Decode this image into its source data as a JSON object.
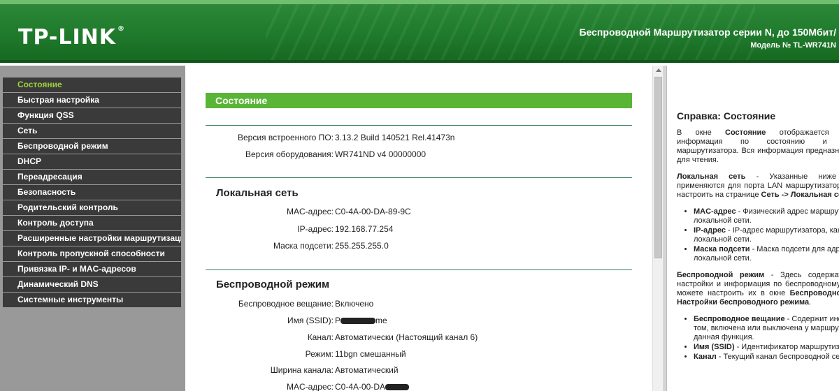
{
  "header": {
    "logo": "TP-LINK",
    "logo_mark": "®",
    "product_title": "Беспроводной Маршрутизатор серии N, до 150Мбит/",
    "model": "Модель № TL-WR741N"
  },
  "sidebar": {
    "items": [
      {
        "label": "Состояние",
        "active": true
      },
      {
        "label": "Быстрая настройка"
      },
      {
        "label": "Функция QSS"
      },
      {
        "label": "Сеть"
      },
      {
        "label": "Беспроводной режим"
      },
      {
        "label": "DHCP"
      },
      {
        "label": "Переадресация"
      },
      {
        "label": "Безопасность"
      },
      {
        "label": "Родительский контроль"
      },
      {
        "label": "Контроль доступа"
      },
      {
        "label": "Расширенные настройки маршрутизации"
      },
      {
        "label": "Контроль пропускной способности"
      },
      {
        "label": "Привязка IP- и MAC-адресов"
      },
      {
        "label": "Динамический DNS"
      },
      {
        "label": "Системные инструменты"
      }
    ]
  },
  "main": {
    "section_title": "Состояние",
    "firmware_label": "Версия встроенного ПО:",
    "firmware_value": "3.13.2 Build 140521 Rel.41473n",
    "hardware_label": "Версия оборудования:",
    "hardware_value": "WR741ND v4 00000000",
    "lan": {
      "title": "Локальная сеть",
      "mac_label": "MAC-адрес:",
      "mac_value": "C0-4A-00-DA-89-9C",
      "ip_label": "IP-адрес:",
      "ip_value": "192.168.77.254",
      "mask_label": "Маска подсети:",
      "mask_value": "255.255.255.0"
    },
    "wireless": {
      "title": "Беспроводной режим",
      "broadcast_label": "Беспроводное вещание:",
      "broadcast_value": "Включено",
      "ssid_label": "Имя (SSID):",
      "ssid_value": "P",
      "ssid_tail": "me",
      "channel_label": "Канал:",
      "channel_value": "Автоматически (Настоящий канал 6)",
      "mode_label": "Режим:",
      "mode_value": "11bgn смешанный",
      "width_label": "Ширина канала:",
      "width_value": "Автоматический",
      "mac_label": "MAC-адрес:",
      "mac_value": "C0-4A-00-DA"
    }
  },
  "help": {
    "title": "Справка: Состояние",
    "intro_1": "В окне ",
    "intro_b": "Состояние",
    "intro_2": " отображается техническая информация по состоянию и настройкам маршрутизатора. Вся информация предназначена только для чтения.",
    "lan_b": "Локальная сеть",
    "lan_text": " - Указанные ниже параметры применяются для порта LAN маршрутизатора. Их можно настроить на странице ",
    "lan_link": "Сеть -> Локальная сеть",
    "lan_end": ".",
    "lan_items": [
      {
        "b": "MAC-адрес",
        "t": " - Физический адрес маршрутизатора в локальной сети."
      },
      {
        "b": "IP-адрес",
        "t": " - IP-адрес маршрутизатора, как он виден из локальной сети."
      },
      {
        "b": "Маска подсети",
        "t": " - Маска подсети для адресов локальной сети."
      }
    ],
    "wl_b": "Беспроводной режим",
    "wl_text": " - Здесь содержатся текущие настройки и информация по беспроводному режиму. Вы можете настроить их в окне ",
    "wl_link": "Беспроводной режим -> Настройки беспроводного режима",
    "wl_end": ".",
    "wl_items": [
      {
        "b": "Беспроводное вещание",
        "t": " - Содержит информацию о том, включена или выключена у маршрутизатора данная функция."
      },
      {
        "b": "Имя (SSID)",
        "t": " - Идентификатор маршрутизатора."
      },
      {
        "b": "Канал",
        "t": " - Текущий канал беспроводной сети."
      }
    ]
  }
}
